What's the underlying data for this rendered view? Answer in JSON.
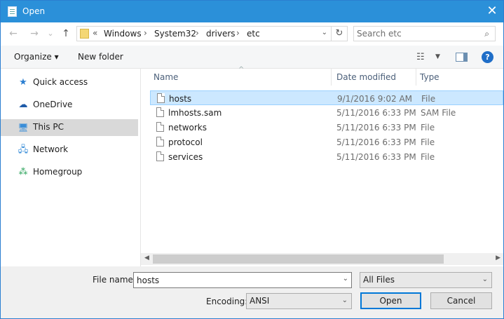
{
  "window": {
    "title": "Open",
    "close_glyph": "✕"
  },
  "nav": {
    "back_glyph": "←",
    "forward_glyph": "→",
    "recent_glyph": "⌄",
    "up_glyph": "↑",
    "overflow": "«",
    "path": [
      "Windows",
      "System32",
      "drivers",
      "etc"
    ],
    "separator": "›",
    "dropdown_glyph": "⌄",
    "refresh_glyph": "↻"
  },
  "search": {
    "placeholder": "Search etc",
    "icon_glyph": "⌕"
  },
  "toolbar": {
    "organize_label": "Organize ▾",
    "new_folder_label": "New folder",
    "view_glyph": "☷",
    "view_dropdown_glyph": "▼",
    "help_label": "?"
  },
  "sidebar": {
    "items": [
      {
        "label": "Quick access",
        "icon": "star-icon",
        "glyph": "★",
        "color": "#2b7fd1",
        "selected": false
      },
      {
        "label": "OneDrive",
        "icon": "cloud-icon",
        "glyph": "☁",
        "color": "#1e5aa8",
        "selected": false
      },
      {
        "label": "This PC",
        "icon": "computer-icon",
        "glyph": "🖥",
        "color": "#3a8ed8",
        "selected": true
      },
      {
        "label": "Network",
        "icon": "network-icon",
        "glyph": "🖧",
        "color": "#3a8ed8",
        "selected": false
      },
      {
        "label": "Homegroup",
        "icon": "homegroup-icon",
        "glyph": "⁂",
        "color": "#2aa35a",
        "selected": false
      }
    ]
  },
  "files": {
    "columns": [
      "Name",
      "Date modified",
      "Type"
    ],
    "sort_glyph": "^",
    "rows": [
      {
        "name": "hosts",
        "date": "9/1/2016 9:02 AM",
        "type": "File",
        "selected": true
      },
      {
        "name": "lmhosts.sam",
        "date": "5/11/2016 6:33 PM",
        "type": "SAM File",
        "selected": false
      },
      {
        "name": "networks",
        "date": "5/11/2016 6:33 PM",
        "type": "File",
        "selected": false
      },
      {
        "name": "protocol",
        "date": "5/11/2016 6:33 PM",
        "type": "File",
        "selected": false
      },
      {
        "name": "services",
        "date": "5/11/2016 6:33 PM",
        "type": "File",
        "selected": false
      }
    ],
    "scroll_left_glyph": "◀",
    "scroll_right_glyph": "▶"
  },
  "footer": {
    "file_name_label": "File name:",
    "file_name_value": "hosts",
    "file_type_value": "All Files",
    "encoding_label": "Encoding:",
    "encoding_value": "ANSI",
    "dropdown_glyph": "⌄",
    "open_label": "Open",
    "cancel_label": "Cancel"
  }
}
